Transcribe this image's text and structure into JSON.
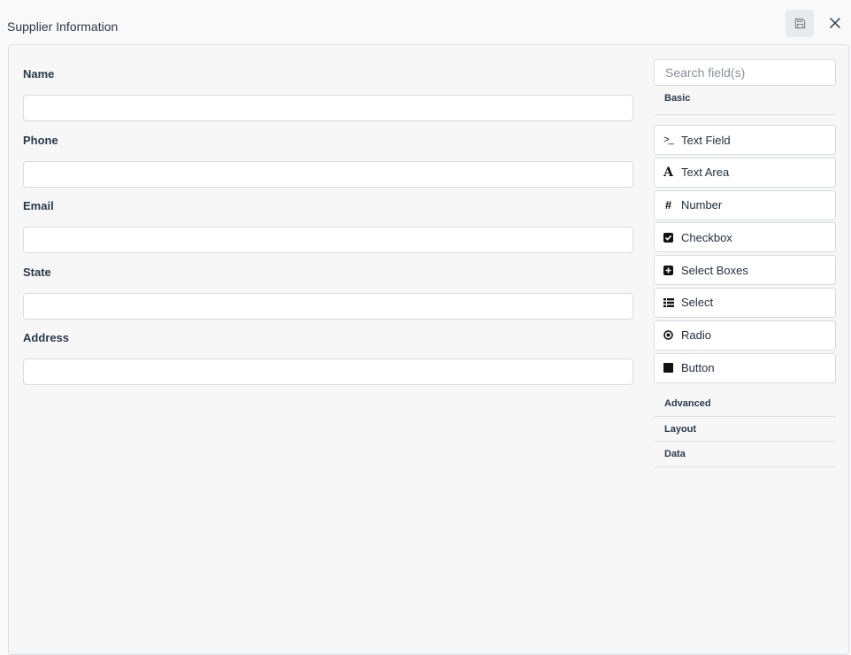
{
  "header": {
    "title": "Supplier Information"
  },
  "form": {
    "fields": [
      {
        "label": "Name",
        "value": ""
      },
      {
        "label": "Phone",
        "value": ""
      },
      {
        "label": "Email",
        "value": ""
      },
      {
        "label": "State",
        "value": ""
      },
      {
        "label": "Address",
        "value": ""
      }
    ]
  },
  "sidebar": {
    "search_placeholder": "Search field(s)",
    "groups": {
      "basic": "Basic",
      "advanced": "Advanced",
      "layout": "Layout",
      "data": "Data"
    },
    "items": [
      {
        "label": "Text Field",
        "icon": "terminal-icon"
      },
      {
        "label": "Text Area",
        "icon": "font-icon"
      },
      {
        "label": "Number",
        "icon": "hashtag-icon"
      },
      {
        "label": "Checkbox",
        "icon": "check-square-icon"
      },
      {
        "label": "Select Boxes",
        "icon": "plus-square-icon"
      },
      {
        "label": "Select",
        "icon": "list-icon"
      },
      {
        "label": "Radio",
        "icon": "dot-circle-icon"
      },
      {
        "label": "Button",
        "icon": "stop-icon"
      }
    ]
  },
  "colors": {
    "background": "#f9f9fa",
    "panel_border": "#dcdfe3",
    "input_border": "#d7dbe0",
    "text": "#1f2d3d"
  }
}
